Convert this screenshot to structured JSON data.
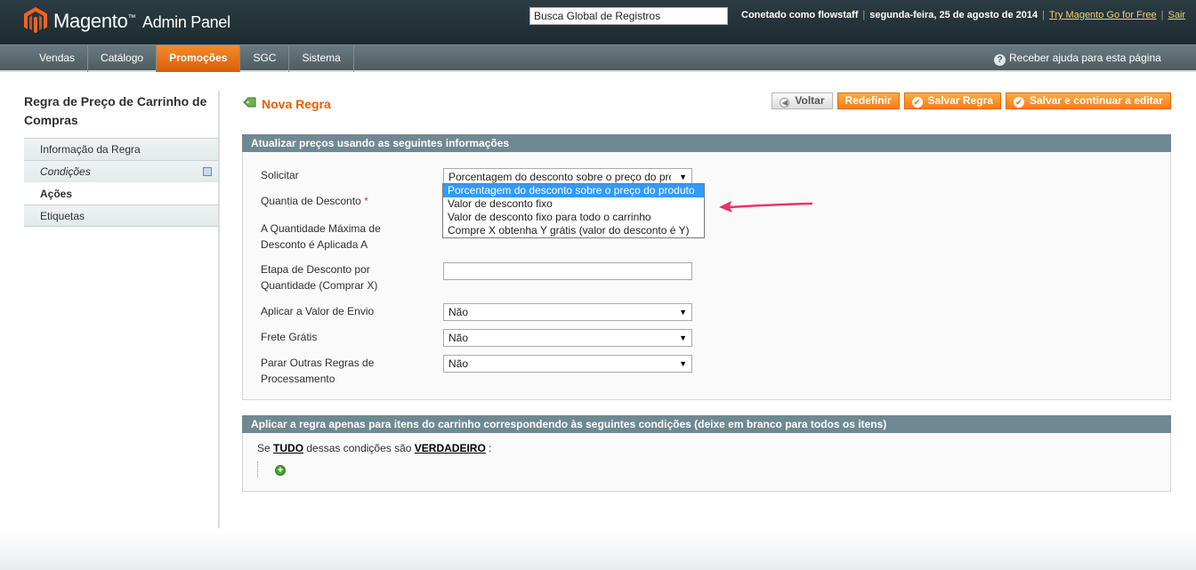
{
  "header": {
    "logo_name": "Magento",
    "logo_tm": "™",
    "logo_sub": "Admin Panel",
    "search_value": "Busca Global de Registros",
    "user_text": "Conetado como flowstaff",
    "date_text": "segunda-feira, 25 de agosto de 2014",
    "try_link": "Try Magento Go for Free",
    "logout_link": "Sair",
    "separator": "|"
  },
  "nav": {
    "items": [
      "Vendas",
      "Catálogo",
      "Promoções",
      "SGC",
      "Sistema"
    ],
    "active": "Promoções",
    "help_label": "Receber ajuda para esta página"
  },
  "sidebar": {
    "title": "Regra de Preço de Carrinho de Compras",
    "tabs": [
      "Informação da Regra",
      "Condições",
      "Ações",
      "Etiquetas"
    ],
    "active_tab": "Ações"
  },
  "content": {
    "title": "Nova Regra",
    "buttons": {
      "back": "Voltar",
      "reset": "Redefinir",
      "save": "Salvar Regra",
      "save_continue": "Salvar e continuar a editar"
    }
  },
  "actions_fieldset": {
    "legend": "Atualizar preços usando as seguintes informações",
    "fields": {
      "apply_label": "Solicitar",
      "apply_value": "Porcentagem do desconto sobre o preço do produto",
      "discount_amount_label": "Quantia de Desconto",
      "required_mark": "*",
      "max_qty_label": "A Quantidade Máxima de Desconto é Aplicada A",
      "discount_step_label": "Etapa de Desconto por Quantidade (Comprar X)",
      "discount_step_value": "",
      "apply_shipping_label": "Aplicar a Valor de Envio",
      "apply_shipping_value": "Não",
      "free_shipping_label": "Frete Grátis",
      "free_shipping_value": "Não",
      "stop_rules_label": "Parar Outras Regras de Processamento",
      "stop_rules_value": "Não"
    },
    "apply_options": [
      "Porcentagem do desconto sobre o preço do produto",
      "Valor de desconto fixo",
      "Valor de desconto fixo para todo o carrinho",
      "Compre X obtenha Y grátis (valor do desconto é Y)"
    ]
  },
  "conditions_fieldset": {
    "legend": "Aplicar a regra apenas para itens do carrinho correspondendo às seguintes condições (deixe em branco para todos os itens)",
    "prefix": "Se",
    "aggregator": "TUDO",
    "middle": "dessas condições são",
    "value": "VERDADEIRO",
    "suffix": ":"
  },
  "colors": {
    "accent": "#eb5e00",
    "header_bg": "#23343a",
    "fieldset_head": "#6f8992",
    "arrow": "#e8336b"
  }
}
